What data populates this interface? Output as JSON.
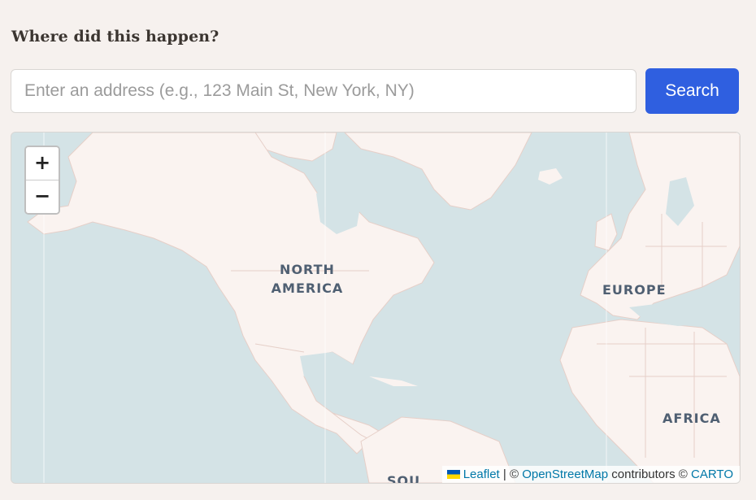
{
  "form": {
    "question": "Where did this happen?",
    "address_placeholder": "Enter an address (e.g., 123 Main St, New York, NY)",
    "address_value": "",
    "search_label": "Search"
  },
  "map": {
    "zoom_in": "+",
    "zoom_out": "−",
    "labels": {
      "north_america_1": "NORTH",
      "north_america_2": "AMERICA",
      "europe": "EUROPE",
      "africa": "AFRICA",
      "south_america_partial": "SOU"
    },
    "attribution": {
      "leaflet": "Leaflet",
      "sep": " | © ",
      "osm": "OpenStreetMap",
      "contrib": " contributors © ",
      "carto": "CARTO"
    },
    "colors": {
      "water": "#d4e3e6",
      "land": "#faf3f0",
      "border": "#e6cfc8",
      "accent": "#2f5fe0"
    }
  }
}
